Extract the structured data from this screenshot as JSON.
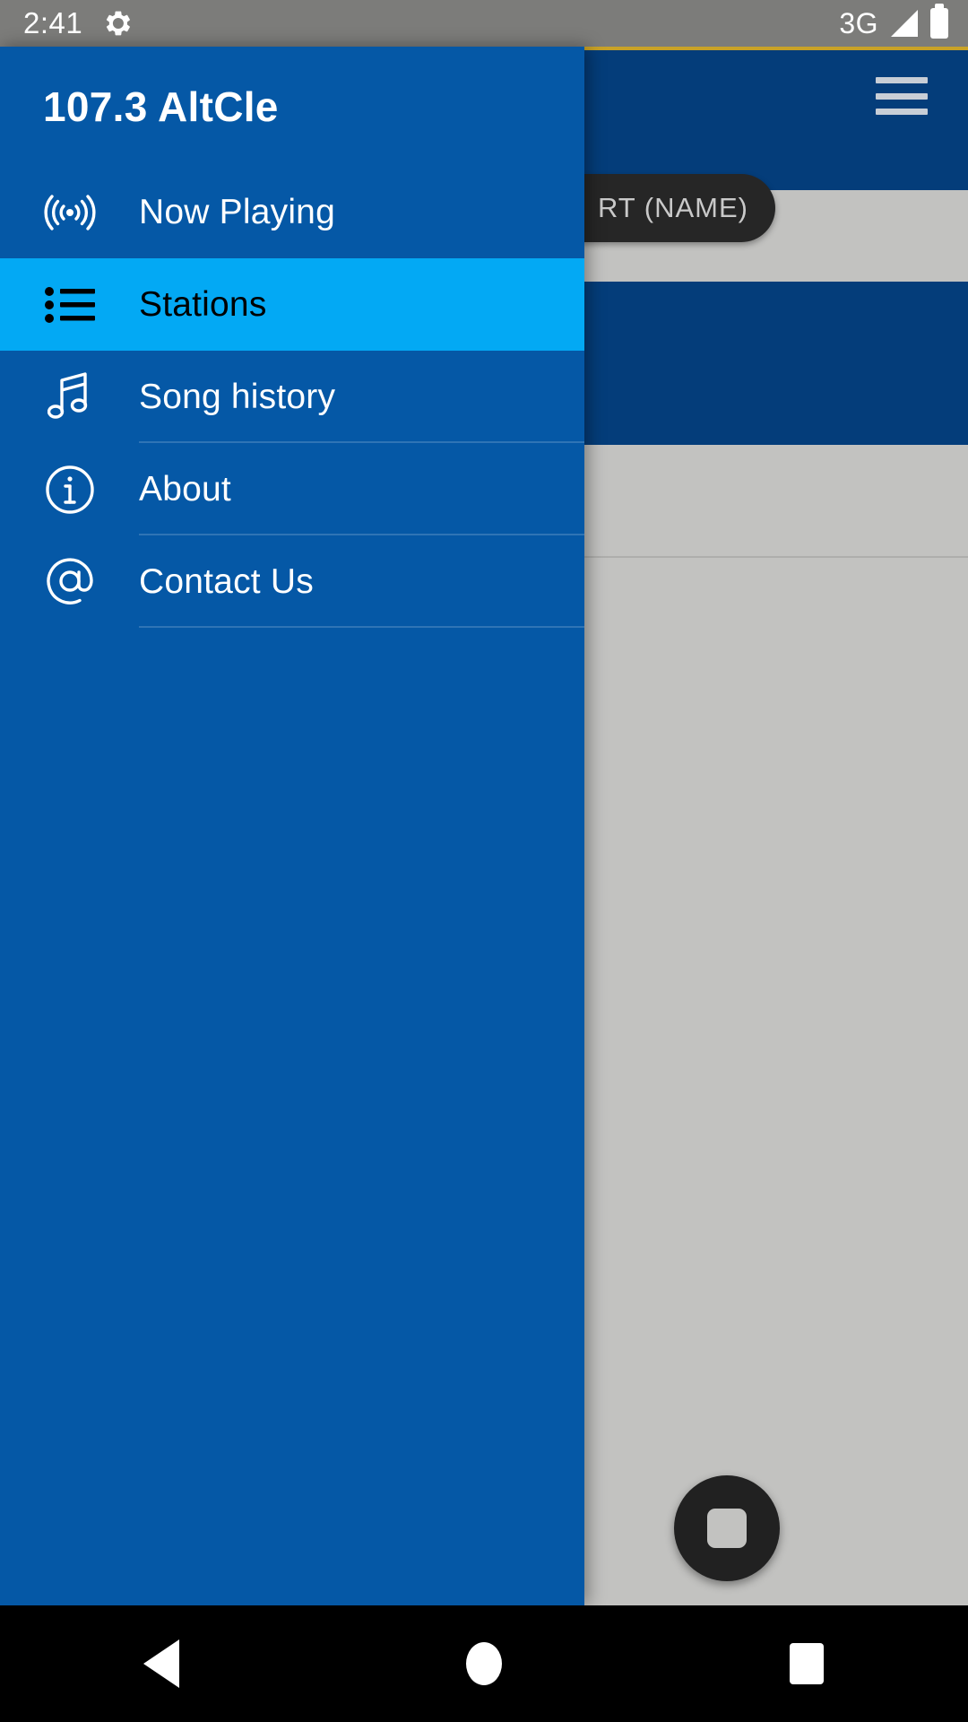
{
  "status_bar": {
    "time": "2:41",
    "gear_icon": "gear-icon",
    "network": "3G",
    "signal_icon": "signal-triangle-icon",
    "battery_icon": "battery-full-icon"
  },
  "app_behind": {
    "menu_icon": "hamburger-menu-icon",
    "chip_label": "RT (NAME)",
    "fab_icon": "stop-icon",
    "accent_top_line_color": "#c9a227",
    "app_bar_color": "#043d7a",
    "scrim_color": "#c2c2c0"
  },
  "drawer": {
    "title": "107.3 AltCle",
    "background_color": "#0558a6",
    "selected_color": "#03a9f4",
    "items": [
      {
        "label": "Now Playing",
        "icon": "broadcast-waves-icon",
        "selected": false,
        "divider": false
      },
      {
        "label": "Stations",
        "icon": "list-bullets-icon",
        "selected": true,
        "divider": false
      },
      {
        "label": "Song history",
        "icon": "music-note-icon",
        "selected": false,
        "divider": true
      },
      {
        "label": "About",
        "icon": "info-circle-icon",
        "selected": false,
        "divider": true
      },
      {
        "label": "Contact Us",
        "icon": "at-sign-icon",
        "selected": false,
        "divider": true
      }
    ]
  },
  "system_nav": {
    "back": "back-triangle-icon",
    "home": "home-circle-icon",
    "recents": "recents-square-icon"
  }
}
